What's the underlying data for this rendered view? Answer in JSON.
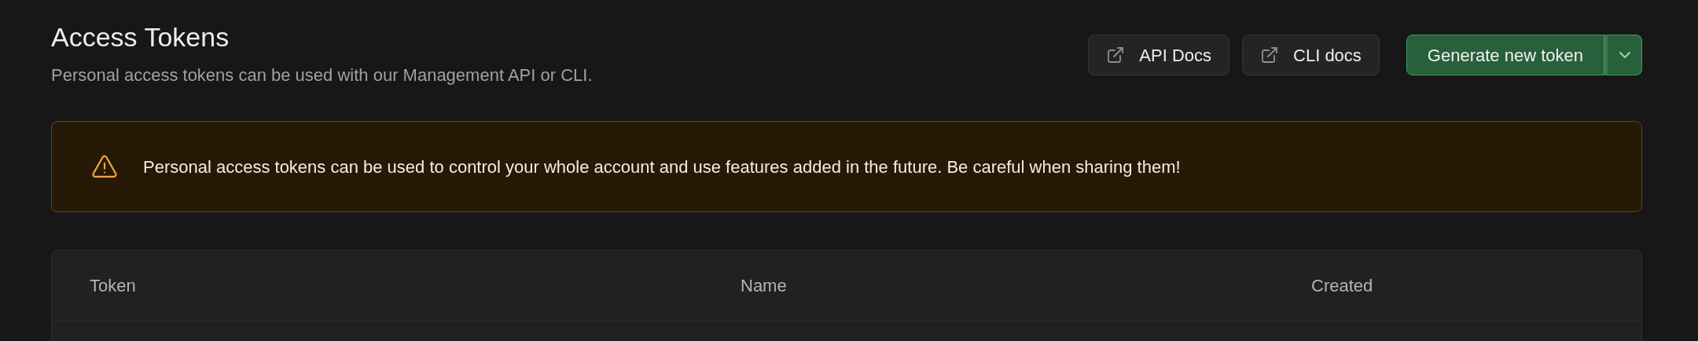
{
  "header": {
    "title": "Access Tokens",
    "subtitle": "Personal access tokens can be used with our Management API or CLI."
  },
  "actions": [
    {
      "kind": "link",
      "label": "API Docs"
    },
    {
      "kind": "link",
      "label": "CLI docs"
    },
    {
      "kind": "split",
      "label": "Generate new token"
    }
  ],
  "alert": {
    "text": "Personal access tokens can be used to control your whole account and use features added in the future. Be careful when sharing them!"
  },
  "table": {
    "columns": [
      "Token",
      "Name",
      "Created"
    ]
  }
}
